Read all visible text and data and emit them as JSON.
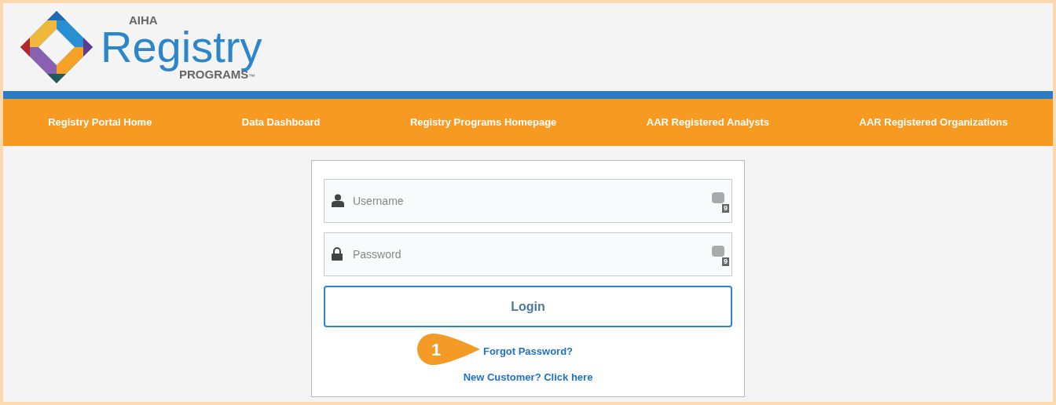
{
  "logo": {
    "top": "AIHA",
    "main": "Registry",
    "sub": "PROGRAMS",
    "mark": "™"
  },
  "nav": [
    {
      "label": "Registry Portal Home"
    },
    {
      "label": "Data Dashboard"
    },
    {
      "label": "Registry Programs Homepage"
    },
    {
      "label": "AAR Registered Analysts"
    },
    {
      "label": "AAR Registered Organizations"
    }
  ],
  "fields": [
    {
      "kind": "user",
      "placeholder": "Username",
      "badge": "9"
    },
    {
      "kind": "lock",
      "placeholder": "Password",
      "badge": "9"
    }
  ],
  "login_button": "Login",
  "callout": "1",
  "links": [
    "Forgot Password?",
    "New Customer? Click here"
  ]
}
